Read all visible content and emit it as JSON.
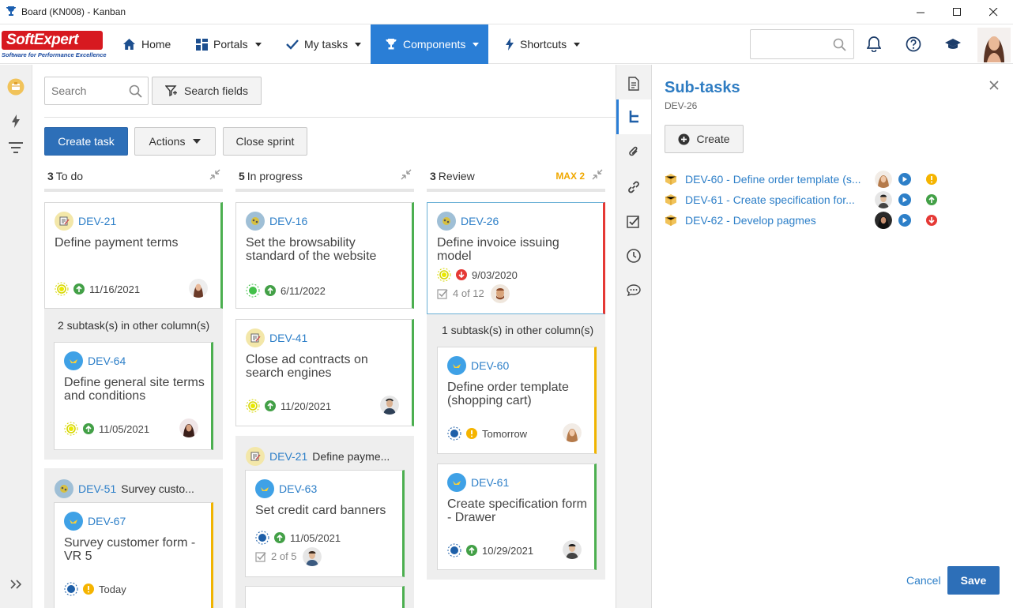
{
  "window": {
    "title": "Board (KN008) - Kanban"
  },
  "navbar": {
    "logo_text": "SoftExpert",
    "logo_tagline": "Software for Performance Excellence",
    "items": [
      {
        "label": "Home"
      },
      {
        "label": "Portals"
      },
      {
        "label": "My tasks"
      },
      {
        "label": "Components"
      },
      {
        "label": "Shortcuts"
      }
    ],
    "search_placeholder": ""
  },
  "board": {
    "search_placeholder": "Search",
    "search_fields_label": "Search fields",
    "create_task_label": "Create task",
    "actions_label": "Actions",
    "close_sprint_label": "Close sprint",
    "columns": [
      {
        "count": "3",
        "name": "To do",
        "max": ""
      },
      {
        "count": "5",
        "name": "In progress",
        "max": ""
      },
      {
        "count": "3",
        "name": "Review",
        "max": "MAX 2"
      }
    ],
    "todo": {
      "card1": {
        "id": "DEV-21",
        "title": "Define payment terms",
        "date": "11/16/2021"
      },
      "sub_note": "2 subtask(s) in other column(s)",
      "card2": {
        "id": "DEV-64",
        "title": "Define general site terms and conditions",
        "date": "11/05/2021"
      },
      "group": {
        "id": "DEV-51",
        "title": "Survey custo..."
      },
      "card3": {
        "id": "DEV-67",
        "title": "Survey customer form - VR 5",
        "date": "Today"
      }
    },
    "inprogress": {
      "card1": {
        "id": "DEV-16",
        "title": "Set the browsability standard of the website",
        "date": "6/11/2022"
      },
      "card2": {
        "id": "DEV-41",
        "title": "Close ad contracts on search engines",
        "date": "11/20/2021"
      },
      "group": {
        "id": "DEV-21",
        "title": "Define payme..."
      },
      "card3": {
        "id": "DEV-63",
        "title": "Set credit card banners",
        "date": "11/05/2021",
        "checklist": "2 of 5"
      }
    },
    "review": {
      "card1": {
        "id": "DEV-26",
        "title": "Define invoice issuing model",
        "date": "9/03/2020",
        "checklist": "4 of 12"
      },
      "sub_note": "1 subtask(s) in other column(s)",
      "card2": {
        "id": "DEV-60",
        "title": "Define order template (shopping cart)",
        "date": "Tomorrow"
      },
      "card3": {
        "id": "DEV-61",
        "title": "Create specification form - Drawer",
        "date": "10/29/2021"
      }
    }
  },
  "panel": {
    "title": "Sub-tasks",
    "subtitle": "DEV-26",
    "create_label": "Create",
    "subtasks": [
      {
        "label": "DEV-60 - Define order template (s...",
        "status_color": "#f5b400"
      },
      {
        "label": "DEV-61 - Create specification for...",
        "status_color": "#43a047"
      },
      {
        "label": "DEV-62 - Develop pagmes",
        "status_color": "#e53935"
      }
    ],
    "cancel_label": "Cancel",
    "save_label": "Save"
  },
  "colors": {
    "accent": "#2a7ed6",
    "primary_button": "#2d6fb8",
    "link": "#2d7fc8",
    "logo_red": "#d71920"
  }
}
